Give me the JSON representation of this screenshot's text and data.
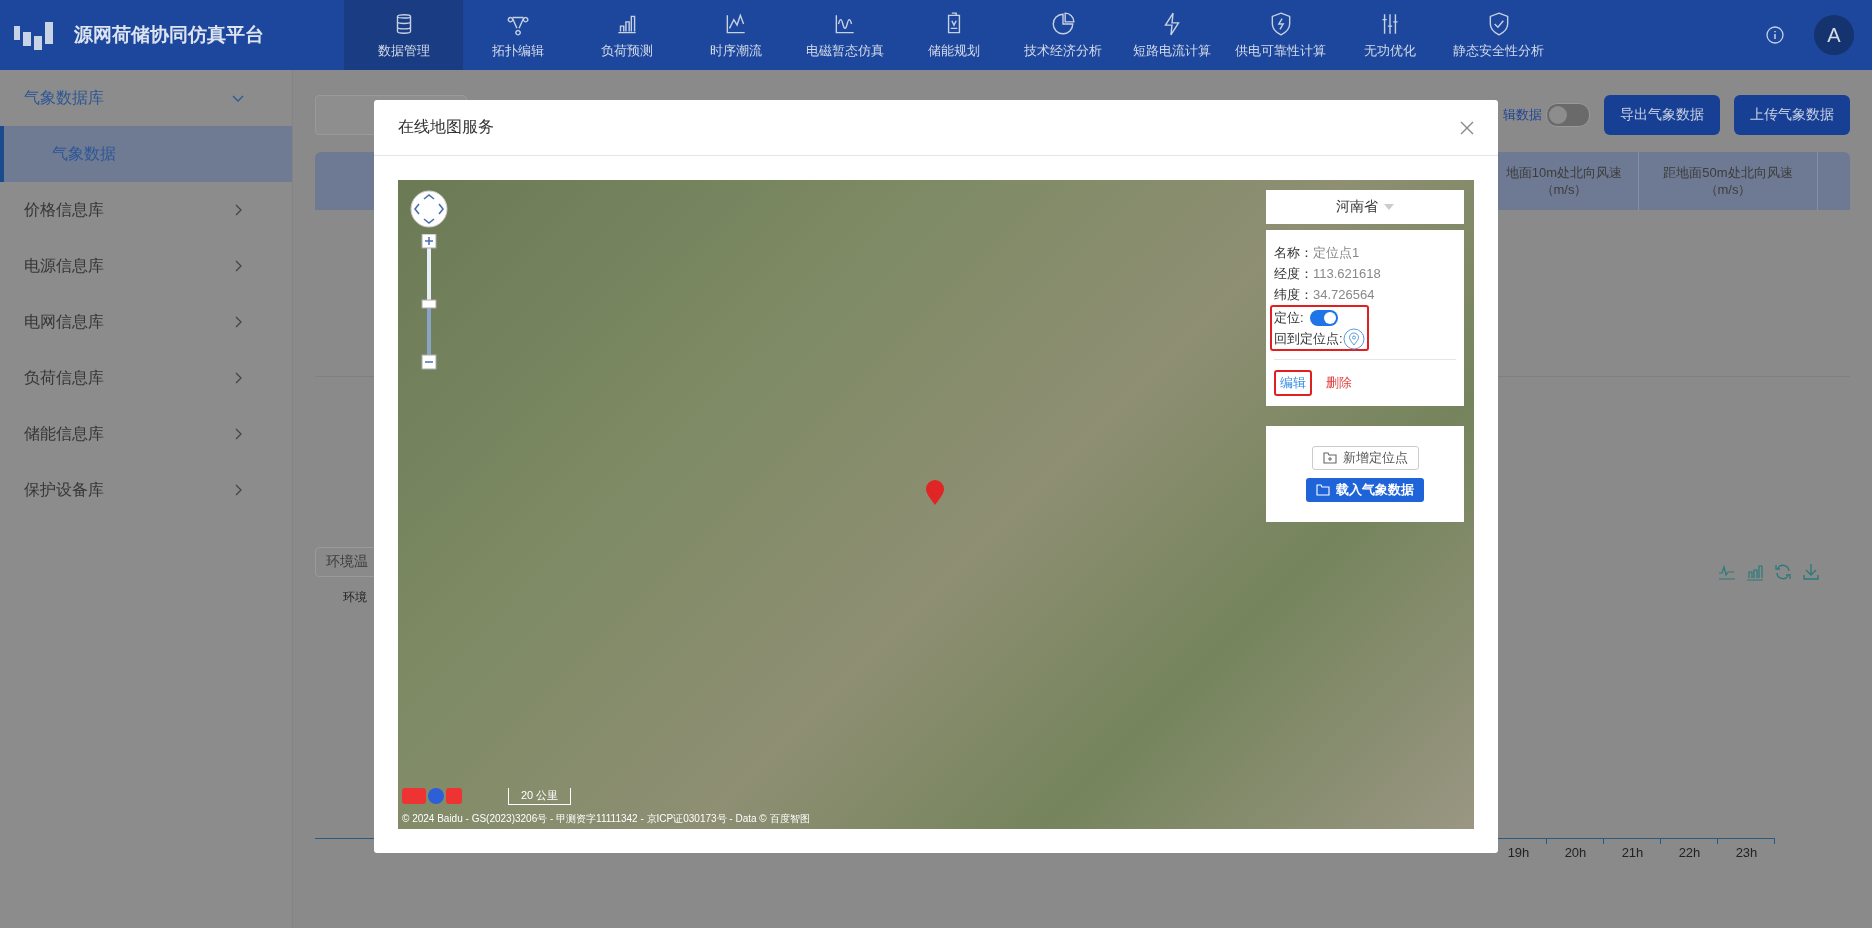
{
  "header": {
    "title": "源网荷储协同仿真平台",
    "nav": [
      {
        "label": "数据管理",
        "selected": true
      },
      {
        "label": "拓扑编辑",
        "selected": false
      },
      {
        "label": "负荷预测",
        "selected": false
      },
      {
        "label": "时序潮流",
        "selected": false
      },
      {
        "label": "电磁暂态仿真",
        "selected": false
      },
      {
        "label": "储能规划",
        "selected": false
      },
      {
        "label": "技术经济分析",
        "selected": false
      },
      {
        "label": "短路电流计算",
        "selected": false
      },
      {
        "label": "供电可靠性计算",
        "selected": false
      },
      {
        "label": "无功优化",
        "selected": false
      },
      {
        "label": "静态安全性分析",
        "selected": false
      }
    ],
    "avatar": "A"
  },
  "sidebar": {
    "groups": [
      {
        "label": "气象数据库",
        "expanded": true,
        "children": [
          {
            "label": "气象数据",
            "selected": true
          }
        ]
      },
      {
        "label": "价格信息库",
        "expanded": false
      },
      {
        "label": "电源信息库",
        "expanded": false
      },
      {
        "label": "电网信息库",
        "expanded": false
      },
      {
        "label": "负荷信息库",
        "expanded": false
      },
      {
        "label": "储能信息库",
        "expanded": false
      },
      {
        "label": "保护设备库",
        "expanded": false
      }
    ]
  },
  "toolbar": {
    "toggle_label": "辑数据",
    "toggle_on": false,
    "buttons": [
      "导出气象数据",
      "上传气象数据"
    ]
  },
  "table": {
    "columns": [
      {
        "name": "地面10m处北向风速",
        "unit": "（m/s）"
      },
      {
        "name": "距地面50m处北向风速",
        "unit": "（m/s）"
      }
    ]
  },
  "chart_panel": {
    "select": "环境温",
    "label": "环境",
    "x_labels": [
      "19h",
      "20h",
      "21h",
      "22h",
      "23h"
    ]
  },
  "dialog": {
    "title": "在线地图服务",
    "map": {
      "province": "河南省",
      "zoom": {
        "level": 0.5
      },
      "point": {
        "fields": [
          {
            "label": "名称：",
            "value": "定位点1"
          },
          {
            "label": "经度：",
            "value": "113.621618"
          },
          {
            "label": "纬度：",
            "value": "34.726564"
          }
        ],
        "locate_label": "定位:",
        "locate_on": true,
        "return_label": "回到定位点:",
        "locate_highlighted": true,
        "actions": [
          {
            "label": "编辑",
            "kind": "edit",
            "highlighted": true
          },
          {
            "label": "删除",
            "kind": "delete",
            "highlighted": false
          }
        ]
      },
      "buttons": [
        {
          "label": "新增定位点",
          "kind": "outline"
        },
        {
          "label": "载入气象数据",
          "kind": "primary"
        }
      ],
      "scale": "20 公里",
      "copyright": "© 2024 Baidu - GS(2023)3206号 - 甲测资字11111342 - 京ICP证030173号 - Data © 百度智图"
    }
  }
}
